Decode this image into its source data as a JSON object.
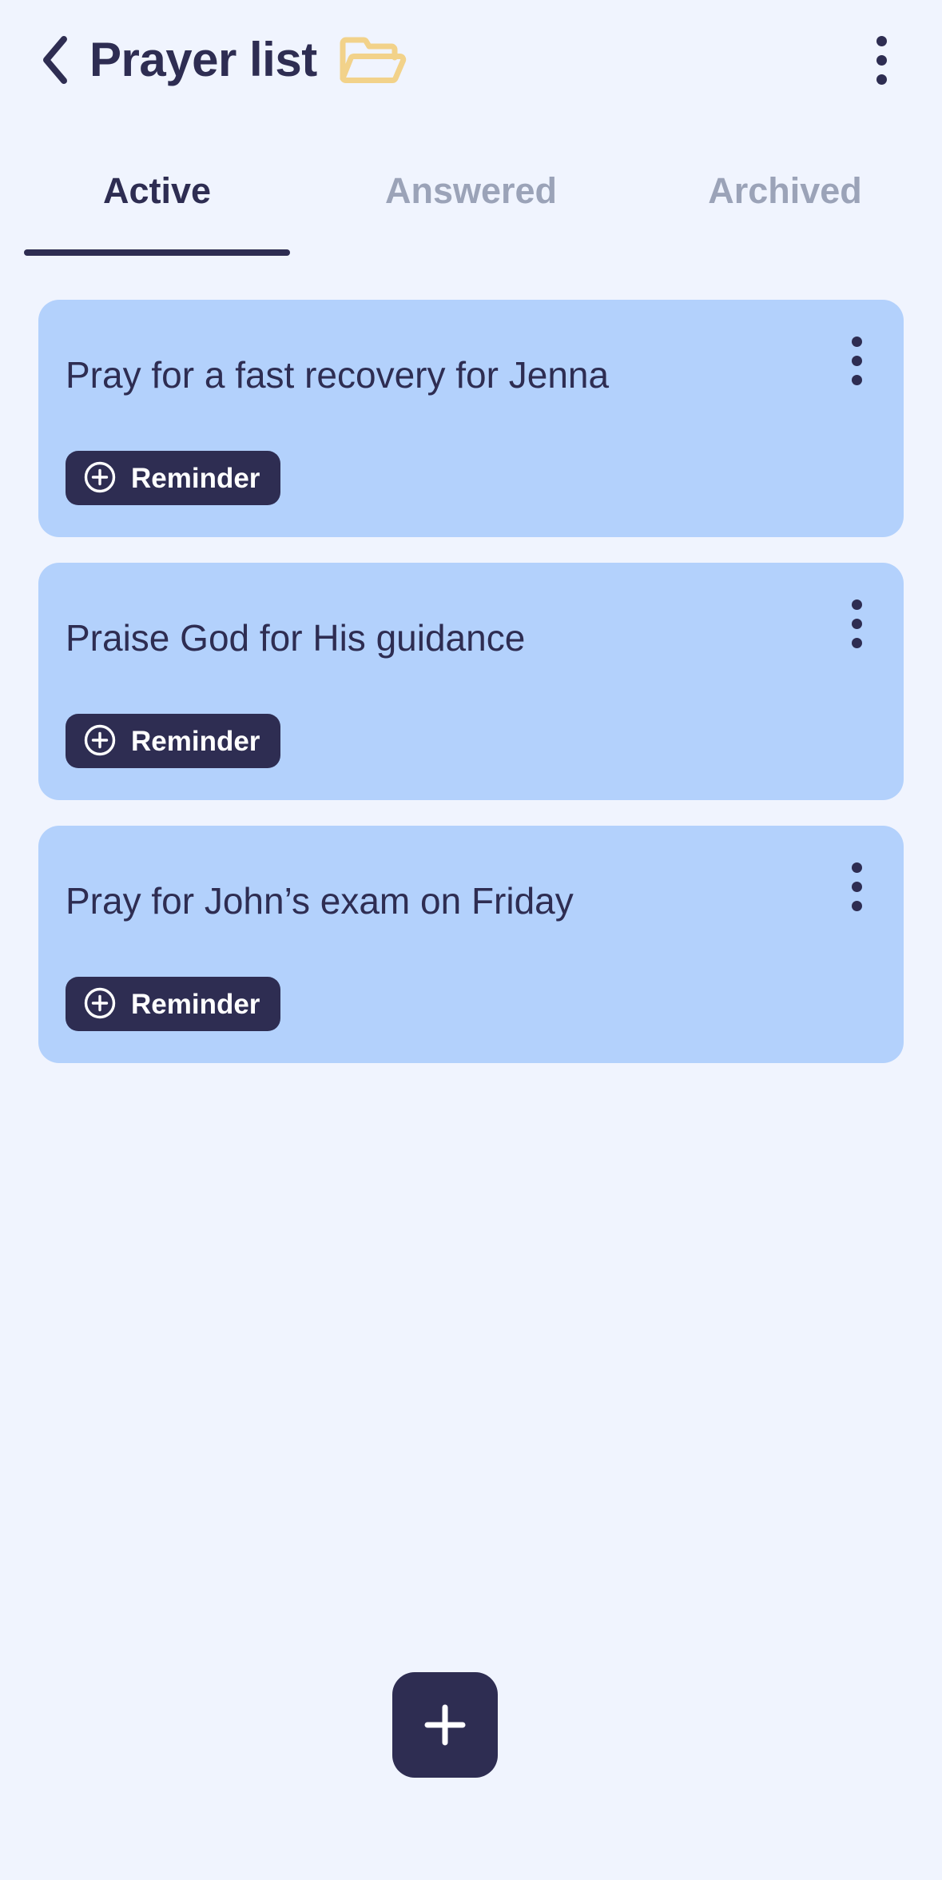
{
  "header": {
    "title": "Prayer list",
    "back_icon": "chevron-left-icon",
    "folder_icon": "folder-open-icon",
    "menu_icon": "more-vertical-icon",
    "folder_color": "#F2D28A",
    "title_color": "#2E2D52"
  },
  "tabs": {
    "items": [
      {
        "label": "Active",
        "selected": true
      },
      {
        "label": "Answered",
        "selected": false
      },
      {
        "label": "Archived",
        "selected": false
      }
    ],
    "active_color": "#2E2D52",
    "inactive_color": "#9BA3B8"
  },
  "prayers": [
    {
      "text": "Pray for a fast recovery for Jenna",
      "reminder_label": "Reminder",
      "reminder_icon": "plus-circle-icon",
      "menu_icon": "more-vertical-icon"
    },
    {
      "text": "Praise God for His guidance",
      "reminder_label": "Reminder",
      "reminder_icon": "plus-circle-icon",
      "menu_icon": "more-vertical-icon"
    },
    {
      "text": "Pray for John’s exam on Friday",
      "reminder_label": "Reminder",
      "reminder_icon": "plus-circle-icon",
      "menu_icon": "more-vertical-icon"
    }
  ],
  "fab": {
    "icon": "plus-icon",
    "background": "#2E2D52"
  },
  "theme": {
    "page_background": "#F0F4FE",
    "card_background": "#B3D1FC",
    "dark": "#2E2D52"
  }
}
